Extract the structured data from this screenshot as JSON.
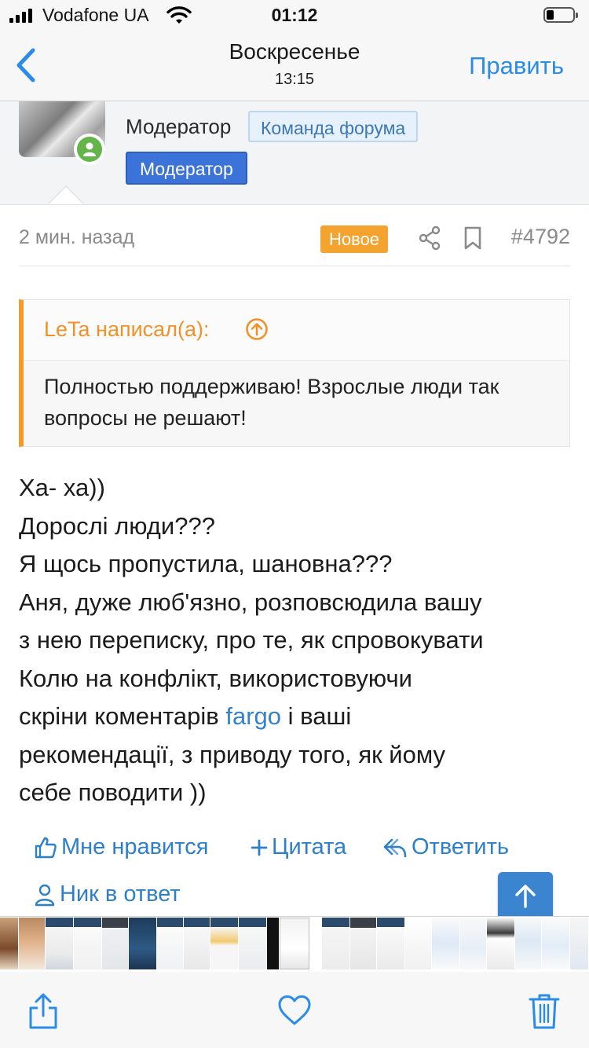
{
  "status_bar": {
    "carrier": "Vodafone UA",
    "time": "01:12"
  },
  "nav": {
    "title": "Воскресенье",
    "subtitle": "13:15",
    "edit_label": "Править"
  },
  "user": {
    "title": "Модератор",
    "team_badge": "Команда форума",
    "role_badge": "Модератор"
  },
  "post": {
    "time": "2 мин. назад",
    "new_badge": "Новое",
    "number": "#4792",
    "quote": {
      "author": "LeTa написал(а):",
      "text": "Полностью поддерживаю! Взрослые люди так вопросы не решают!"
    },
    "message": {
      "line1": "Ха- ха))",
      "line2": "Дорослі люди???",
      "line3": "Я щось пропустила, шановна???",
      "line4": "Аня, дуже люб'язно, розповсюдила вашу",
      "line5": "з нею переписку, про те, як спровокувати",
      "line6": "Колю на конфлікт, використовуючи",
      "line7_pre": "скріни коментарів ",
      "line7_link": "fargo",
      "line7_post": " і ваші",
      "line8": "рекомендації, з приводу того, як йому",
      "line9": "себе поводити ))"
    },
    "actions": {
      "like": "Мне нравится",
      "quote": "Цитата",
      "reply": "Ответить",
      "mention": "Ник в ответ"
    }
  },
  "colors": {
    "accent": "#2b8ce8",
    "link": "#2d7fc9",
    "quote_bar": "#f39a2a",
    "new_badge": "#f5a32f",
    "role_badge": "#3b73d8"
  },
  "icons": {
    "status": [
      "signal-icon",
      "wifi-icon",
      "battery-icon"
    ],
    "nav": [
      "back-chevron-icon"
    ],
    "post": [
      "share-icon",
      "bookmark-icon",
      "quote-up-arrow-icon"
    ],
    "actions": [
      "thumbs-up-icon",
      "plus-icon",
      "reply-arrow-icon",
      "user-icon",
      "arrow-up-icon"
    ],
    "toolbar": [
      "share-icon",
      "heart-icon",
      "trash-icon"
    ]
  }
}
